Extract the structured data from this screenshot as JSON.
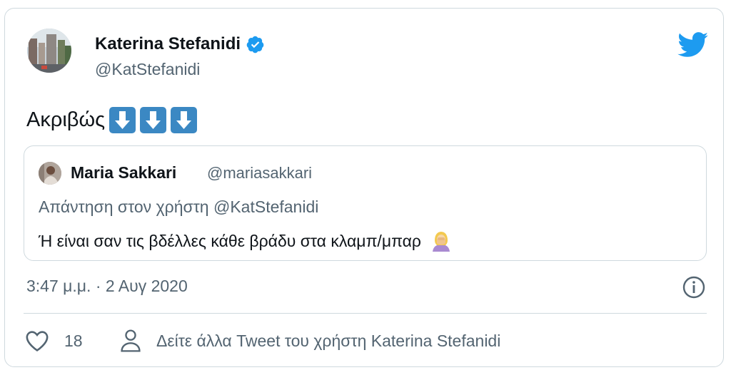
{
  "author": {
    "name": "Katerina Stefanidi",
    "handle": "@KatStefanidi",
    "verified": true
  },
  "tweet": {
    "text": "Ακριβώς",
    "emojis": [
      "down-arrow-button",
      "down-arrow-button",
      "down-arrow-button"
    ],
    "timestamp": "3:47 μ.μ. · 2 Αυγ 2020"
  },
  "quoted": {
    "name": "Maria Sakkari",
    "handle": "@mariasakkari",
    "reply_to": "Απάντηση στον χρήστη @KatStefanidi",
    "text": "Ή είναι σαν τις βδέλλες κάθε βράδυ στα κλαμπ/μπαρ",
    "emoji": "woman-facepalming"
  },
  "actions": {
    "likes": "18",
    "see_more": "Δείτε άλλα Tweet του χρήστη Katerina Stefanidi"
  },
  "colors": {
    "twitter_blue": "#1d9bf0",
    "arrow_blue": "#3b88c3",
    "secondary_text": "#536471",
    "border": "#cfd9de"
  }
}
